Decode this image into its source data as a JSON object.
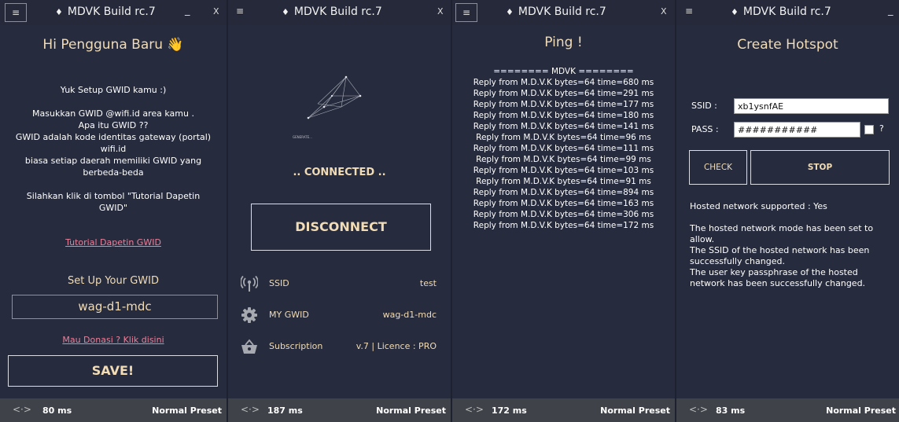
{
  "app": {
    "title": "MDVK Build rc.7",
    "minimize": "_",
    "close": "X",
    "menu": "≡",
    "gem": "♦"
  },
  "panel1": {
    "greeting": "Hi Pengguna Baru 👋",
    "lines": [
      "Yuk Setup GWID kamu :)",
      "",
      "Masukkan GWID @wifi.id area kamu .",
      "Apa itu GWID ??",
      "GWID adalah kode identitas gateway (portal)",
      "wifi.id",
      "biasa setiap daerah memiliki GWID yang",
      "berbeda-beda",
      "",
      "Silahkan klik di tombol \"Tutorial Dapetin",
      "GWID\""
    ],
    "tutorial_link": "Tutorial Dapetin GWID",
    "setup_label": "Set Up Your GWID",
    "gwid_value": "wag-d1-mdc",
    "donate_link": "Mau Donasi ? Klik disini",
    "save_label": "SAVE!"
  },
  "panel2": {
    "logo_caption": "GENERATE...",
    "status": ".. CONNECTED ..",
    "disconnect_label": "DISCONNECT",
    "rows": [
      {
        "icon": "wifi-signal-icon",
        "label": "SSID",
        "value": "test"
      },
      {
        "icon": "gear-icon",
        "label": "MY GWID",
        "value": "wag-d1-mdc"
      },
      {
        "icon": "basket-icon",
        "label": "Subscription",
        "value": "v.7 | Licence : PRO"
      }
    ]
  },
  "panel3": {
    "title": "Ping !",
    "header": "======== MDVK ========",
    "replies": [
      "Reply from M.D.V.K bytes=64 time=680 ms",
      "Reply from M.D.V.K bytes=64 time=291 ms",
      "Reply from M.D.V.K bytes=64 time=177 ms",
      "Reply from M.D.V.K bytes=64 time=180 ms",
      "Reply from M.D.V.K bytes=64 time=141 ms",
      "Reply from M.D.V.K bytes=64 time=96 ms",
      "Reply from M.D.V.K bytes=64 time=111 ms",
      "Reply from M.D.V.K bytes=64 time=99 ms",
      "Reply from M.D.V.K bytes=64 time=103 ms",
      "Reply from M.D.V.K bytes=64 time=91 ms",
      "Reply from M.D.V.K bytes=64 time=894 ms",
      "Reply from M.D.V.K bytes=64 time=163 ms",
      "Reply from M.D.V.K bytes=64 time=306 ms",
      "Reply from M.D.V.K bytes=64 time=172 ms"
    ]
  },
  "panel4": {
    "title": "Create Hotspot",
    "ssid_label": "SSID :",
    "ssid_value": "xb1ysnfAE",
    "pass_label": "PASS :",
    "pass_value": "###########",
    "help": "?",
    "check_label": "CHECK",
    "stop_label": "STOP",
    "log": [
      "Hosted network supported : Yes",
      "",
      "The hosted network mode has been set to",
      "allow.",
      "The SSID of the hosted network has been",
      "successfully changed.",
      "The user key passphrase of the hosted",
      "network has been successfully changed."
    ]
  },
  "statusbars": [
    {
      "icon": "<·>",
      "ping": "80 ms",
      "preset": "Normal Preset"
    },
    {
      "icon": "<·>",
      "ping": "187 ms",
      "preset": "Normal Preset"
    },
    {
      "icon": "<·>",
      "ping": "172 ms",
      "preset": "Normal Preset"
    },
    {
      "icon": "<·>",
      "ping": "83 ms",
      "preset": "Normal Preset"
    }
  ],
  "colors": {
    "background": "#262b3d",
    "titlebar": "#252939",
    "statusbar": "#3f4249",
    "accent": "#f1dcb6",
    "link": "#e9819b"
  }
}
